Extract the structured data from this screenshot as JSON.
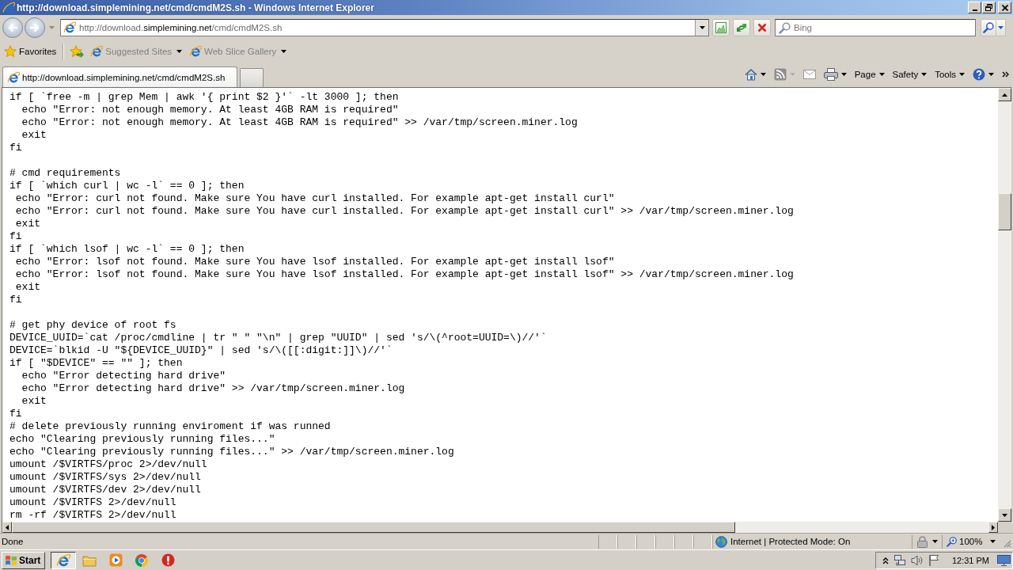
{
  "window": {
    "title": "http://download.simplemining.net/cmd/cmdM2S.sh - Windows Internet Explorer"
  },
  "address_bar": {
    "url": "http://download.**simplemining.net**/cmd/cmdM2S.sh"
  },
  "search": {
    "placeholder": "Bing"
  },
  "favorites_bar": {
    "label": "Favorites",
    "links": [
      {
        "label": "Suggested Sites",
        "disabled": true
      },
      {
        "label": "Web Slice Gallery",
        "disabled": true
      }
    ]
  },
  "tabs": [
    {
      "title": "http://download.simplemining.net/cmd/cmdM2S.sh",
      "selected": true
    }
  ],
  "command_bar": {
    "menus": [
      {
        "label": "Page"
      },
      {
        "label": "Safety"
      },
      {
        "label": "Tools"
      }
    ]
  },
  "document": {
    "blocks": [
      [
        "if [ `free -m | grep Mem | awk '{ print $2 }'` -lt 3000 ]; then",
        "  echo \"Error: not enough memory. At least 4GB RAM is required\"",
        "  echo \"Error: not enough memory. At least 4GB RAM is required\" >> /var/tmp/screen.miner.log",
        "  exit",
        "fi"
      ],
      [
        "# cmd requirements",
        "if [ `which curl | wc -l` == 0 ]; then",
        " echo \"Error: curl not found. Make sure You have curl installed. For example apt-get install curl\"",
        " echo \"Error: curl not found. Make sure You have curl installed. For example apt-get install curl\" >> /var/tmp/screen.miner.log",
        " exit",
        "fi",
        "if [ `which lsof | wc -l` == 0 ]; then",
        " echo \"Error: lsof not found. Make sure You have lsof installed. For example apt-get install lsof\"",
        " echo \"Error: lsof not found. Make sure You have lsof installed. For example apt-get install lsof\" >> /var/tmp/screen.miner.log",
        " exit",
        "fi"
      ],
      [
        "# get phy device of root fs",
        "DEVICE_UUID=`cat /proc/cmdline | tr \" \" \"\\n\" | grep \"UUID\" | sed 's/\\(^root=UUID=\\)//'`",
        "DEVICE=`blkid -U \"${DEVICE_UUID}\" | sed 's/\\([[:digit:]]\\)//'`",
        "if [ \"$DEVICE\" == \"\" ]; then",
        "  echo \"Error detecting hard drive\"",
        "  echo \"Error detecting hard drive\" >> /var/tmp/screen.miner.log",
        "  exit",
        "fi",
        "# delete previously running enviroment if was runned",
        "echo \"Clearing previously running files...\"",
        "echo \"Clearing previously running files...\" >> /var/tmp/screen.miner.log",
        "umount /$VIRTFS/proc 2>/dev/null",
        "umount /$VIRTFS/sys 2>/dev/null",
        "umount /$VIRTFS/dev 2>/dev/null",
        "umount /$VIRTFS 2>/dev/null",
        "rm -rf /$VIRTFS 2>/dev/null"
      ]
    ]
  },
  "status_bar": {
    "text": "Done",
    "zone": "Internet | Protected Mode: On",
    "zoom": "100%"
  },
  "taskbar": {
    "start": "Start",
    "apps": [
      {
        "selected": true
      },
      {
        "selected": false
      },
      {
        "selected": false
      },
      {
        "selected": false
      },
      {
        "selected": false
      }
    ],
    "clock": "12:31 PM"
  }
}
